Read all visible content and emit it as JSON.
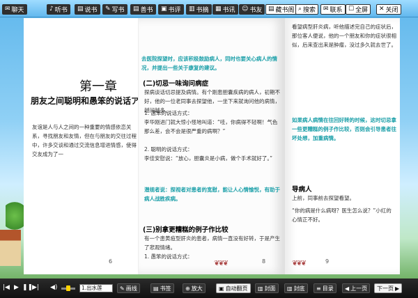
{
  "toolbar": {
    "left": [
      {
        "label": "聊天",
        "icon": "chat-icon"
      },
      {
        "label": "听书",
        "icon": "headphone-icon"
      },
      {
        "label": "说书",
        "icon": "book-icon"
      },
      {
        "label": "写书",
        "icon": "pen-icon"
      },
      {
        "label": "善书",
        "icon": "book-icon"
      },
      {
        "label": "书评",
        "icon": "comment-icon"
      },
      {
        "label": "书摘",
        "icon": "note-icon"
      },
      {
        "label": "书讯",
        "icon": "news-icon"
      },
      {
        "label": "书友",
        "icon": "friends-icon"
      }
    ],
    "right": [
      {
        "label": "藏书阁",
        "icon": "library-icon"
      },
      {
        "label": "搜索",
        "icon": "search-icon"
      },
      {
        "label": "联系",
        "icon": "contact-icon"
      },
      {
        "label": "全屏",
        "icon": "fullscreen-icon"
      },
      {
        "label": "关闭",
        "icon": "close-icon"
      }
    ]
  },
  "book": {
    "left_page": {
      "chapter": "第一章",
      "subtitle": "朋友之间聪明和愚笨的说话ア",
      "paragraph": "友谊是人与人之间的一种重要的情感依恋关系，寻找朋友和友情，但在与朋友的交往过程中，许多交谈和通过交流信息增进情感，使得交友成为了一",
      "page_num": "6"
    },
    "middle_page": {
      "top_note": "去医院探望时，应该积极鼓励病人，同时也要关心病人的情况，并提出一些关于康复的建议。",
      "section1": "(二)切忌一味询问病症",
      "para1": "探病谈话切忌提及病情。有个刚患胆囊疾病的病人，初期不好，他的一位老同事去探望他，一坐下来就询问他的病情，越问越多。",
      "list1": "1. 愚笨的说话方式：",
      "para2": "李华刚进门就大惊小怪地叫道：“哇，你病得不轻啊！气色那么差，会不会是很严重的病啊？”",
      "list2": "2. 聪明的说话方式：",
      "para3": "李佳安慰说：“放心，胆囊炎是小病，做个手术就好了。”",
      "teal_note": "潜规者说：探视者对患者的宽慰，能让人心情愉悦，有助于病人战胜疾病。",
      "section2": "(三)别拿更糟糕的例子作比较",
      "para4": "有一个患黄疸型肝炎的患者，病情一直没有好转，于是产生了悲观情绪。",
      "list3": "1. 愚笨的说话方式：",
      "page_num": "8"
    },
    "right_page": {
      "para1": "看望病型肝炎病，听他描述完自己的症状后，那位客人便说，他的一个朋友和你的症状很相似，后来查出来是肿瘤，没过多久就去世了。",
      "teal_note": "如果病人病情在往回好转的时候，这时切忌拿一些更糟糕的例子作比较，否则会引导患者往坏处想，加重病情。",
      "section": "导病人",
      "para2": "上前，同事前去探望看望。",
      "para3": "“你的病是什么病呀？医生怎么说？”小红的心情正不好。",
      "page_num": "9"
    }
  },
  "bottombar": {
    "speed_select": "1.出水莲",
    "buttons": [
      {
        "label": "画线",
        "icon": "pen-icon"
      },
      {
        "label": "书签",
        "icon": "bookmark-icon"
      },
      {
        "label": "放大",
        "icon": "zoom-in-icon"
      },
      {
        "label": "自动翻页",
        "icon": "auto-flip-icon"
      },
      {
        "label": "封面",
        "icon": "cover-icon"
      },
      {
        "label": "封底",
        "icon": "back-cover-icon"
      },
      {
        "label": "目录",
        "icon": "toc-icon"
      },
      {
        "label": "上一页",
        "icon": "prev-icon"
      },
      {
        "label": "下一页",
        "icon": "next-icon"
      }
    ]
  }
}
